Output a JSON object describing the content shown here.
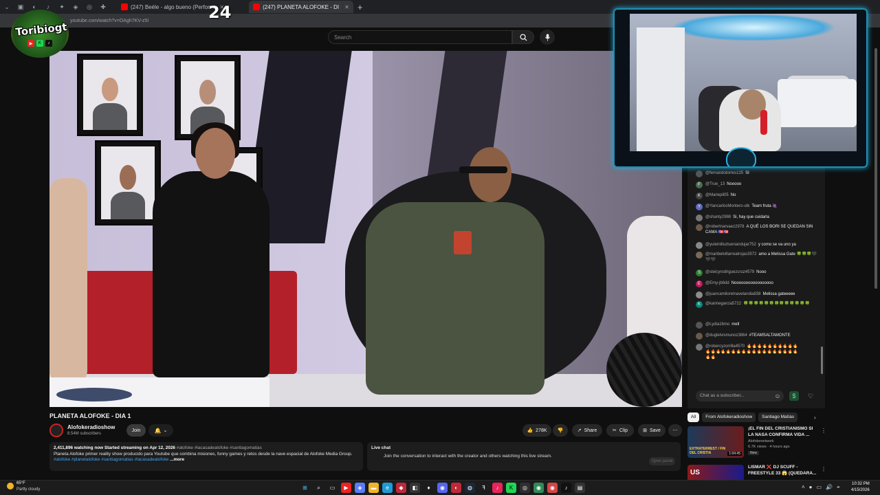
{
  "browser": {
    "tabs": [
      {
        "label": "(247) Beéle - algo bueno (Perform",
        "favicon_color": "#ff0000",
        "active": false
      },
      {
        "label": "(247) PLANETA ALOFOKE - DI",
        "favicon_color": "#ff0000",
        "active": true
      }
    ],
    "url": "youtube.com/watch?v=OAgh7KV-z5I"
  },
  "youtube": {
    "search_placeholder": "Search",
    "video_title": "PLANETA ALOFOKE - DIA 1",
    "channel": {
      "name": "Alofokeradioshow",
      "subscribers": "8.54M subscribers"
    },
    "join_label": "Join",
    "likes": "278K",
    "share_label": "Share",
    "clip_label": "Clip",
    "save_label": "Save",
    "description": {
      "stats": "2,411,896 watching now  Started streaming on Apr 12, 2026",
      "stat_tags": "#alofoke #lacasadealofoke #santiagomatias",
      "body": "Planeta Alofoke primer reality show producido para Youtube que combina misiones, funny games y retos desde la nave espacial de Alofoke Media Group.",
      "tags": "#alofoke #planetalofoke #santiagomatias #lacasadealofoke",
      "more": "...more"
    },
    "live_chat_box": {
      "title": "Live chat",
      "text": "Join the conversation to interact with the creator and others watching this live stream.",
      "button": "Open panel"
    }
  },
  "chat": {
    "messages": [
      {
        "user": "@fernandotorres125",
        "text": "SI",
        "avatar_color": "#555",
        "initial": ""
      },
      {
        "user": "@True_13",
        "text": "Nooooo",
        "avatar_color": "#4a6b4f",
        "initial": "F"
      },
      {
        "user": "@Mariepil05",
        "text": "No",
        "avatar_color": "#444",
        "initial": "K"
      },
      {
        "user": "@YancarlosMontero-utk",
        "text": "Team fruta 🍇",
        "avatar_color": "#5c6bc0",
        "initial": "Y"
      },
      {
        "user": "@shanty2988",
        "text": "Si, hay que cuidarla",
        "avatar_color": "#777",
        "initial": ""
      },
      {
        "user": "@robertnarvaez2978",
        "text": "A QUÉ LOS BORI SE QUEDAN SIN CAMA 🇵🇷🇵🇷",
        "avatar_color": "#6d5a4a",
        "initial": ""
      },
      {
        "user": "@yuleinilluztuenandujar752",
        "text": "y como se va uno ya",
        "avatar_color": "#888",
        "initial": ""
      },
      {
        "user": "@maribelvillarrealrojas3572",
        "text": "amo a Melissa Gate 🍀🍀🍀🖤🖤🖤",
        "avatar_color": "#7a6a55",
        "initial": ""
      },
      {
        "user": "@steicyrodriguezcruz4579",
        "text": "Nooo",
        "avatar_color": "#2e7d32",
        "initial": "S"
      },
      {
        "user": "@Emy-jb6dd",
        "text": "Nooooooooooooooooo",
        "avatar_color": "#c2185b",
        "initial": "E"
      },
      {
        "user": "@juancamilorelnavelandia838",
        "text": "Melissa gateeeee",
        "avatar_color": "#8d8d8d",
        "initial": ""
      },
      {
        "user": "@karinegarcia5722",
        "text": "🍀🍀🍀🍀🍀🍀🍀🍀🍀🍀🍀🍀🍀",
        "avatar_color": "#00897b",
        "initial": "K"
      },
      {
        "user": "@Lydia16mo",
        "text": "mell",
        "avatar_color": "#555",
        "initial": ""
      },
      {
        "user": "@duglelvismunoz3864",
        "text": "#TEAMSALTAMONTE",
        "avatar_color": "#6a5a4a",
        "initial": ""
      },
      {
        "user": "@robercyzorrilla4570",
        "text": "🔥🔥🔥🔥🔥🔥🔥🔥🔥🔥🔥🔥🔥🔥🔥🔥🔥🔥🔥🔥🔥🔥🔥🔥🔥🔥🔥🔥🔥🔥",
        "avatar_color": "#777",
        "initial": ""
      }
    ],
    "input_placeholder": "Chat as a subscriber..."
  },
  "recommendations": {
    "chips": [
      "All",
      "From Alofokeradioshow",
      "Santiago Matías"
    ],
    "items": [
      {
        "title": "¡EL FIN DEL CRISTIANISMO SI LA NASA CONFIRMA VIDA ...",
        "channel": "Alofokenetwork",
        "meta": "6.7K views · 4 hours ago",
        "badge": "New",
        "duration": "1:04:45",
        "thumb_text": "EXTRATERREST / FIN DEL CRISTIA"
      },
      {
        "title": "LISMAR ❌ DJ SCUFF - FREESTYLE 33 😱 (QUEDARA...",
        "channel": "",
        "meta": "",
        "badge": "",
        "duration": "",
        "thumb_text": "US"
      }
    ]
  },
  "overlay": {
    "streamer_logo": "Toribiogt",
    "counter": "24"
  },
  "taskbar": {
    "weather_temp": "65°F",
    "weather_desc": "Partly cloudy",
    "time": "10:32 PM",
    "date": "4/15/2026"
  }
}
